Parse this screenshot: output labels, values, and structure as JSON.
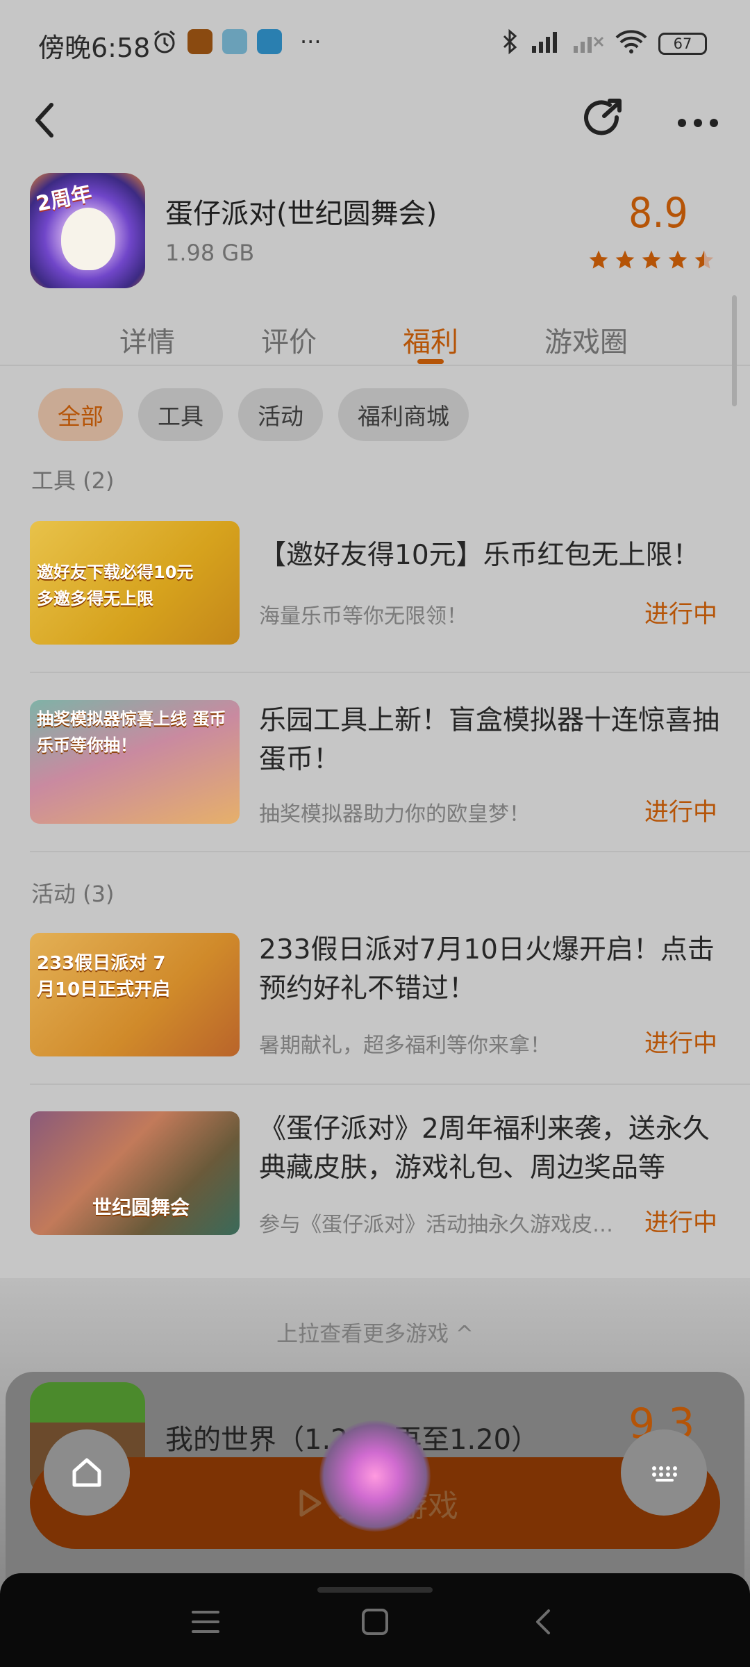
{
  "status_bar": {
    "time": "傍晚6:58",
    "battery": "67",
    "more_indicator": "···"
  },
  "app": {
    "title": "蛋仔派对(世纪圆舞会)",
    "size": "1.98 GB",
    "score": "8.9",
    "rating_stars": 4.5,
    "icon_badge": "2周年"
  },
  "tabs": [
    {
      "label": "详情"
    },
    {
      "label": "评价"
    },
    {
      "label": "福利"
    },
    {
      "label": "游戏圈"
    }
  ],
  "active_tab": "福利",
  "filters": [
    {
      "label": "全部"
    },
    {
      "label": "工具"
    },
    {
      "label": "活动"
    },
    {
      "label": "福利商城"
    }
  ],
  "sections": {
    "tools": "工具 (2)",
    "events": "活动 (3)"
  },
  "items": [
    {
      "title": "【邀好友得10元】乐币红包无上限！",
      "subtitle": "海量乐币等你无限领！",
      "status": "进行中",
      "thumb_text": "邀好友下载必得10元 多邀多得无上限"
    },
    {
      "title": "乐园工具上新！盲盒模拟器十连惊喜抽蛋币！",
      "subtitle": "抽奖模拟器助力你的欧皇梦！",
      "status": "进行中",
      "thumb_text": "抽奖模拟器惊喜上线 蛋币乐币等你抽！"
    },
    {
      "title": "233假日派对7月10日火爆开启！点击预约好礼不错过！",
      "subtitle": "暑期献礼，超多福利等你来拿！",
      "status": "进行中",
      "thumb_text": "233假日派对 7月10日正式开启"
    },
    {
      "title": "《蛋仔派对》2周年福利来袭，送永久典藏皮肤，游戏礼包、周边奖品等",
      "subtitle": "参与《蛋仔派对》活动抽永久游戏皮…",
      "status": "进行中",
      "thumb_text": "世纪圆舞会"
    }
  ],
  "bottom": {
    "pull_up": "上拉查看更多游戏 ^",
    "next_title": "我的世界（1.20恐再至1.20）",
    "next_score": "9.3",
    "play_label": "打开游戏"
  }
}
